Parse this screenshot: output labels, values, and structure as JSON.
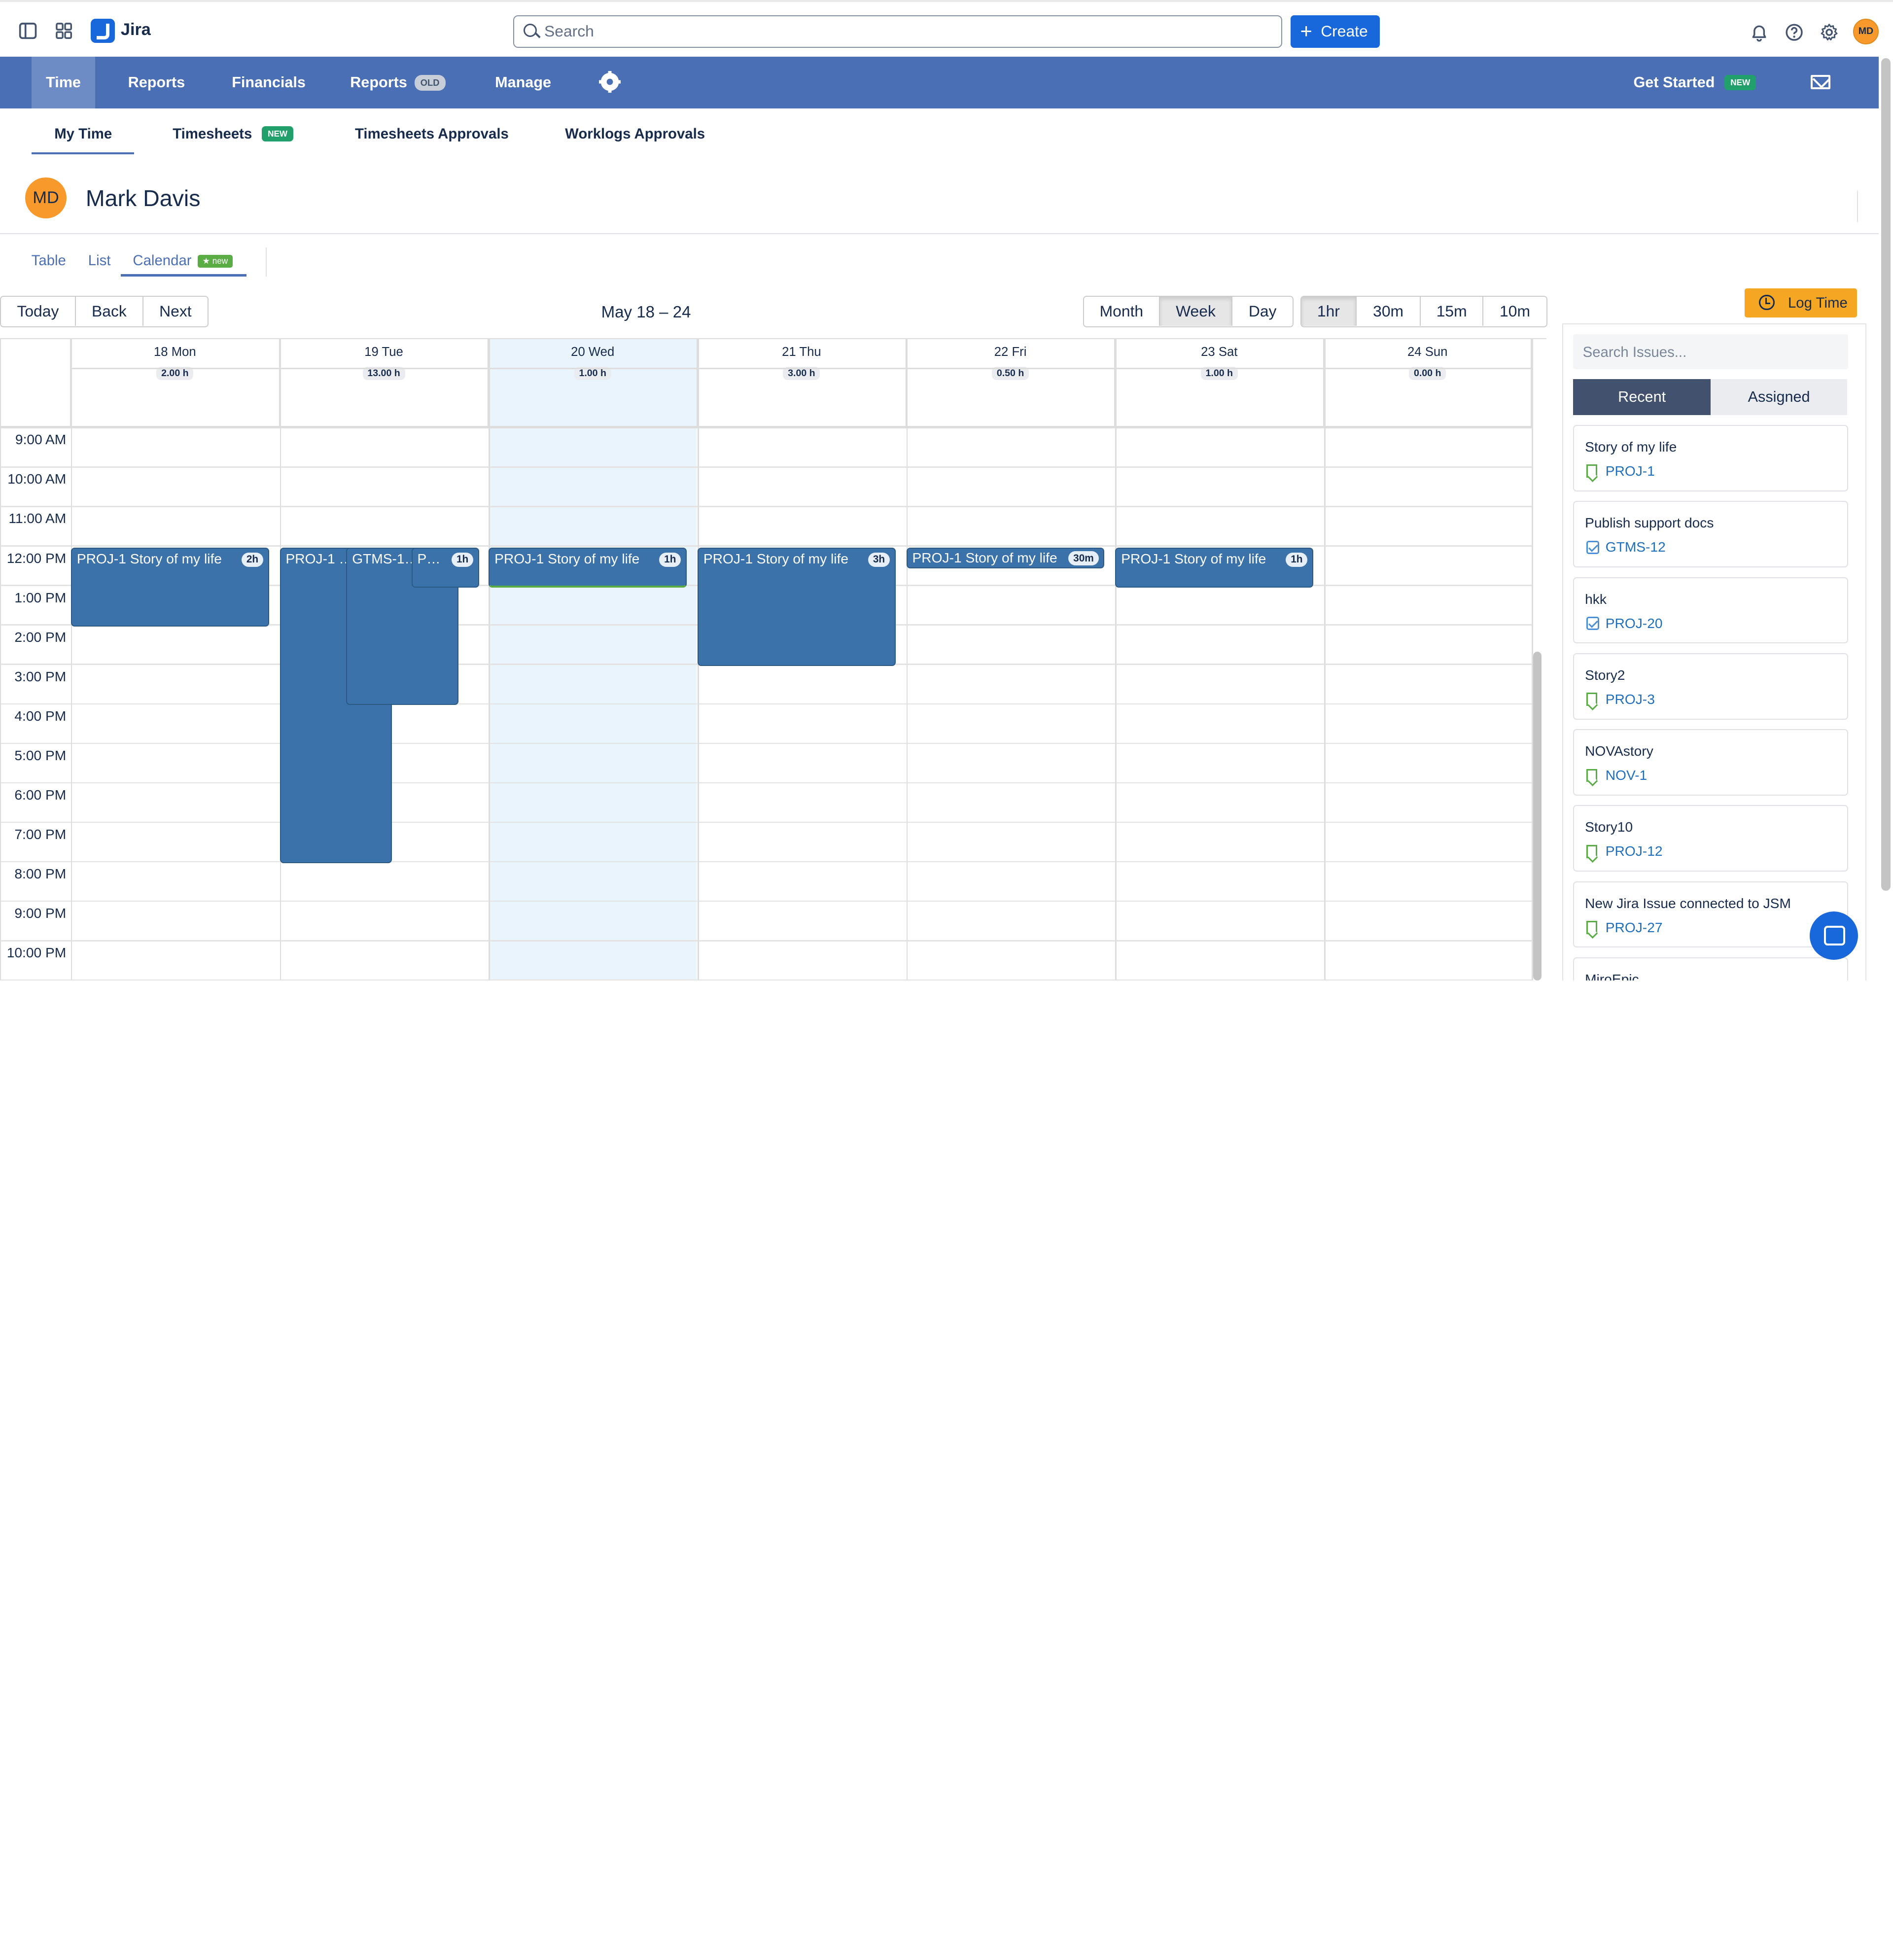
{
  "topbar": {
    "app_name": "Jira",
    "search_placeholder": "Search",
    "create_label": "Create",
    "avatar_initials": "MD"
  },
  "nav": {
    "items": [
      {
        "label": "Time"
      },
      {
        "label": "Reports"
      },
      {
        "label": "Financials"
      },
      {
        "label": "Reports",
        "badge": "OLD"
      },
      {
        "label": "Manage"
      }
    ],
    "get_started": "Get Started",
    "get_started_badge": "NEW"
  },
  "subtabs": [
    {
      "label": "My Time"
    },
    {
      "label": "Timesheets",
      "badge": "NEW"
    },
    {
      "label": "Timesheets Approvals"
    },
    {
      "label": "Worklogs Approvals"
    }
  ],
  "user": {
    "initials": "MD",
    "name": "Mark Davis"
  },
  "view_tabs": [
    {
      "label": "Table"
    },
    {
      "label": "List"
    },
    {
      "label": "Calendar",
      "badge": "★ new"
    }
  ],
  "toolbar": {
    "nav_buttons": [
      "Today",
      "Back",
      "Next"
    ],
    "range_label": "May 18 – 24",
    "view_buttons": [
      "Month",
      "Week",
      "Day"
    ],
    "active_view": "Week",
    "step_buttons": [
      "1hr",
      "30m",
      "15m",
      "10m"
    ],
    "active_step": "1hr"
  },
  "calendar": {
    "days": [
      {
        "label": "18 Mon",
        "hours": "2.00 h"
      },
      {
        "label": "19 Tue",
        "hours": "13.00 h"
      },
      {
        "label": "20 Wed",
        "hours": "1.00 h"
      },
      {
        "label": "21 Thu",
        "hours": "3.00 h"
      },
      {
        "label": "22 Fri",
        "hours": "0.50 h"
      },
      {
        "label": "23 Sat",
        "hours": "1.00 h"
      },
      {
        "label": "24 Sun",
        "hours": "0.00 h"
      }
    ],
    "times": [
      "9:00 AM",
      "10:00 AM",
      "11:00 AM",
      "12:00 PM",
      "1:00 PM",
      "2:00 PM",
      "3:00 PM",
      "4:00 PM",
      "5:00 PM",
      "6:00 PM",
      "7:00 PM",
      "8:00 PM",
      "9:00 PM",
      "10:00 PM"
    ],
    "events": [
      {
        "title": "PROJ-1 Story of my life",
        "duration": "2h"
      },
      {
        "title": "PROJ-1 …",
        "duration": ""
      },
      {
        "title": "GTMS-1…",
        "duration": ""
      },
      {
        "title": "P…",
        "duration": "1h"
      },
      {
        "title": "PROJ-1 Story of my life",
        "duration": "1h"
      },
      {
        "title": "PROJ-1 Story of my life",
        "duration": "3h"
      },
      {
        "title": "PROJ-1 Story of my life",
        "duration": "30m"
      },
      {
        "title": "PROJ-1 Story of my life",
        "duration": "1h"
      }
    ]
  },
  "panel": {
    "log_time": "Log Time",
    "search_placeholder": "Search Issues...",
    "tabs": [
      "Recent",
      "Assigned"
    ],
    "issues": [
      {
        "title": "Story of my life",
        "key": "PROJ-1",
        "icon": "bookmark-icon"
      },
      {
        "title": "Publish support docs",
        "key": "GTMS-12",
        "icon": "task-icon"
      },
      {
        "title": "hkk",
        "key": "PROJ-20",
        "icon": "task-icon"
      },
      {
        "title": "Story2",
        "key": "PROJ-3",
        "icon": "bookmark-icon"
      },
      {
        "title": "NOVAstory",
        "key": "NOV-1",
        "icon": "bookmark-icon"
      },
      {
        "title": "Story10",
        "key": "PROJ-12",
        "icon": "bookmark-icon"
      },
      {
        "title": "New Jira Issue connected to JSM",
        "key": "PROJ-27",
        "icon": "bookmark-icon"
      },
      {
        "title": "MiroEpic",
        "key": "",
        "icon": ""
      }
    ]
  }
}
